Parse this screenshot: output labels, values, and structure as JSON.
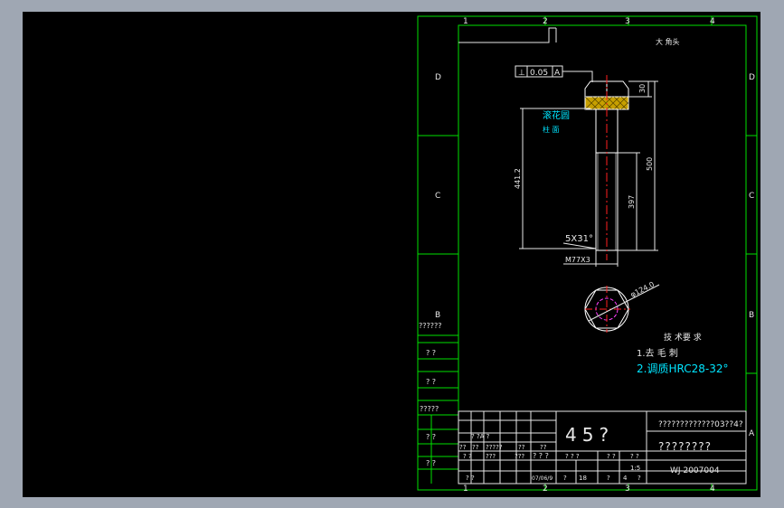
{
  "frame": {
    "zone_numbers": [
      "1",
      "2",
      "3",
      "4"
    ],
    "zone_letters": [
      "D",
      "C",
      "B",
      "A"
    ]
  },
  "part_title": "大 角头",
  "tolerance_frame": {
    "symbol": "⊥",
    "value": "0.05",
    "datum": "A"
  },
  "callouts": {
    "knurl": "滚花圆",
    "column": "柱 面"
  },
  "dims": {
    "d30": "30",
    "d500": "500",
    "d441": "441.2",
    "d397": "397",
    "chamfer": "5X31°",
    "thread": "M77X3",
    "diameter": "φ124.0"
  },
  "tech_req": {
    "heading": "技 术要 求",
    "items": [
      "1.去 毛 刺",
      "2.调质HRC28-32°"
    ]
  },
  "left_strip": [
    "??????",
    "?  ?",
    "?  ?",
    "?????",
    "?  ?",
    "?  ?"
  ],
  "title_block": {
    "material": "45?",
    "company": "?????????????03??4?",
    "drawing_name": "????????",
    "drawing_no": "WJ-2007004",
    "scale": "1:5",
    "row_a": [
      "??",
      "??",
      "?????",
      "??",
      "??"
    ],
    "row_b": [
      "? ?",
      "???",
      "???",
      "? ? ?",
      "? ? ?",
      "? ?",
      "? ?"
    ],
    "row_c": [
      "? ?",
      "07/06/9",
      "?",
      "18",
      "?",
      "4",
      "?"
    ],
    "small_a": "? ?A ?"
  }
}
